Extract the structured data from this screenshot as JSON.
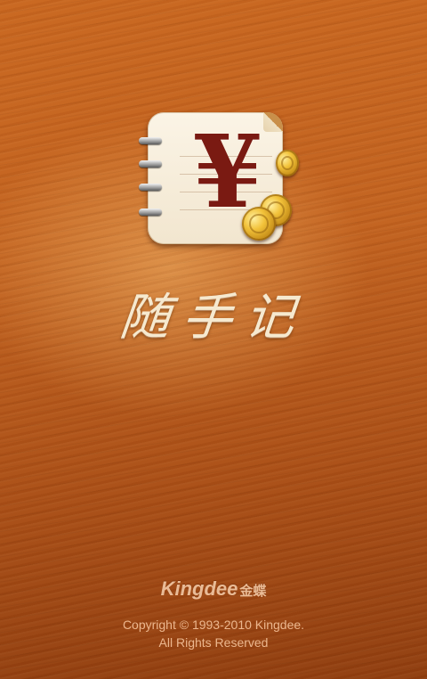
{
  "splash": {
    "app_name": "随手记",
    "app_icon_symbol": "¥",
    "brand": {
      "name": "Kingdee",
      "cn_name": "金蝶"
    },
    "copyright_line1": "Copyright © 1993-2010 Kingdee.",
    "copyright_line2": "All Rights Reserved"
  },
  "colors": {
    "wood_base": "#c2621f",
    "icon_paper": "#f2e6cf",
    "yen_red": "#7a1a12",
    "coin_gold": "#f2c23a",
    "title_cream": "#f6e9cf",
    "footer_text": "#f5c39b"
  },
  "icons": [
    "app-icon",
    "coin-icon"
  ]
}
